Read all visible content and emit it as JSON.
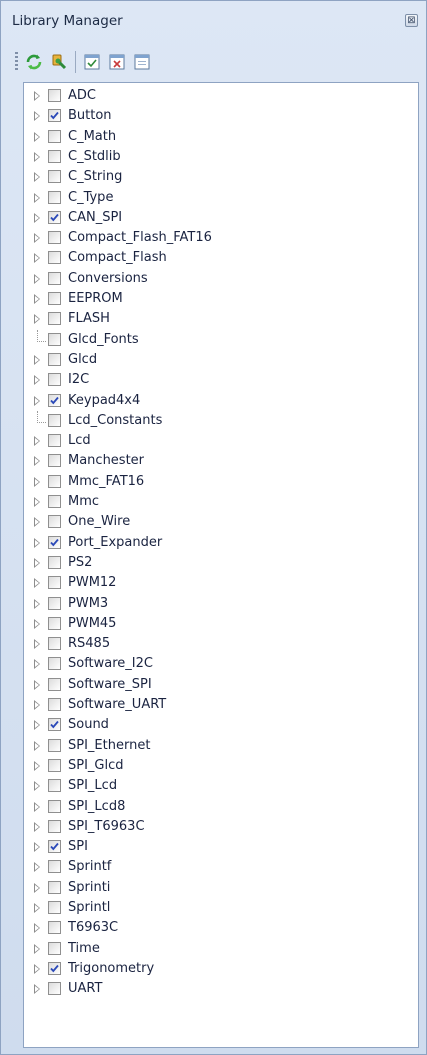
{
  "window": {
    "title": "Library Manager",
    "close_glyph": "⊠"
  },
  "toolbar": {
    "buttons": [
      {
        "icon": "refresh-icon"
      },
      {
        "icon": "library-icon"
      },
      {
        "icon": "checked-page-icon"
      },
      {
        "icon": "unchecked-page-icon"
      },
      {
        "icon": "page-icon"
      }
    ]
  },
  "libraries": [
    {
      "label": "ADC",
      "checked": false,
      "expandable": true
    },
    {
      "label": "Button",
      "checked": true,
      "expandable": true
    },
    {
      "label": "C_Math",
      "checked": false,
      "expandable": true
    },
    {
      "label": "C_Stdlib",
      "checked": false,
      "expandable": true
    },
    {
      "label": "C_String",
      "checked": false,
      "expandable": true
    },
    {
      "label": "C_Type",
      "checked": false,
      "expandable": true
    },
    {
      "label": "CAN_SPI",
      "checked": true,
      "expandable": true
    },
    {
      "label": "Compact_Flash_FAT16",
      "checked": false,
      "expandable": true
    },
    {
      "label": "Compact_Flash",
      "checked": false,
      "expandable": true
    },
    {
      "label": "Conversions",
      "checked": false,
      "expandable": true
    },
    {
      "label": "EEPROM",
      "checked": false,
      "expandable": true
    },
    {
      "label": "FLASH",
      "checked": false,
      "expandable": true
    },
    {
      "label": "Glcd_Fonts",
      "checked": false,
      "expandable": false
    },
    {
      "label": "Glcd",
      "checked": false,
      "expandable": true
    },
    {
      "label": "I2C",
      "checked": false,
      "expandable": true
    },
    {
      "label": "Keypad4x4",
      "checked": true,
      "expandable": true
    },
    {
      "label": "Lcd_Constants",
      "checked": false,
      "expandable": false
    },
    {
      "label": "Lcd",
      "checked": false,
      "expandable": true
    },
    {
      "label": "Manchester",
      "checked": false,
      "expandable": true
    },
    {
      "label": "Mmc_FAT16",
      "checked": false,
      "expandable": true
    },
    {
      "label": "Mmc",
      "checked": false,
      "expandable": true
    },
    {
      "label": "One_Wire",
      "checked": false,
      "expandable": true
    },
    {
      "label": "Port_Expander",
      "checked": true,
      "expandable": true
    },
    {
      "label": "PS2",
      "checked": false,
      "expandable": true
    },
    {
      "label": "PWM12",
      "checked": false,
      "expandable": true
    },
    {
      "label": "PWM3",
      "checked": false,
      "expandable": true
    },
    {
      "label": "PWM45",
      "checked": false,
      "expandable": true
    },
    {
      "label": "RS485",
      "checked": false,
      "expandable": true
    },
    {
      "label": "Software_I2C",
      "checked": false,
      "expandable": true
    },
    {
      "label": "Software_SPI",
      "checked": false,
      "expandable": true
    },
    {
      "label": "Software_UART",
      "checked": false,
      "expandable": true
    },
    {
      "label": "Sound",
      "checked": true,
      "expandable": true
    },
    {
      "label": "SPI_Ethernet",
      "checked": false,
      "expandable": true
    },
    {
      "label": "SPI_Glcd",
      "checked": false,
      "expandable": true
    },
    {
      "label": "SPI_Lcd",
      "checked": false,
      "expandable": true
    },
    {
      "label": "SPI_Lcd8",
      "checked": false,
      "expandable": true
    },
    {
      "label": "SPI_T6963C",
      "checked": false,
      "expandable": true
    },
    {
      "label": "SPI",
      "checked": true,
      "expandable": true
    },
    {
      "label": "Sprintf",
      "checked": false,
      "expandable": true
    },
    {
      "label": "Sprinti",
      "checked": false,
      "expandable": true
    },
    {
      "label": "Sprintl",
      "checked": false,
      "expandable": true
    },
    {
      "label": "T6963C",
      "checked": false,
      "expandable": true
    },
    {
      "label": "Time",
      "checked": false,
      "expandable": true
    },
    {
      "label": "Trigonometry",
      "checked": true,
      "expandable": true
    },
    {
      "label": "UART",
      "checked": false,
      "expandable": true
    }
  ],
  "colors": {
    "check": "#2b49b8",
    "panel": "#cfdcee",
    "tree_bg": "#ffffff"
  }
}
